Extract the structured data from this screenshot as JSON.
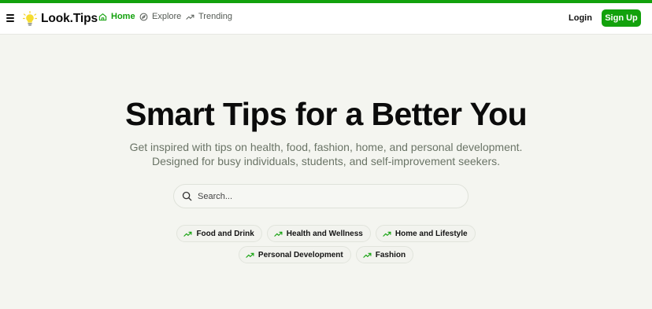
{
  "colors": {
    "accent": "#12a10c",
    "text_muted": "#6a7466",
    "background": "#f4f5f0"
  },
  "header": {
    "menu_icon": "hamburger-icon",
    "logo_icon": "lightbulb-icon",
    "brand": "Look.Tips",
    "nav": [
      {
        "label": "Home",
        "icon": "home-icon",
        "active": true
      },
      {
        "label": "Explore",
        "icon": "compass-icon",
        "active": false
      },
      {
        "label": "Trending",
        "icon": "trending-up-icon",
        "active": false
      }
    ],
    "login_label": "Login",
    "signup_label": "Sign Up"
  },
  "hero": {
    "title": "Smart Tips for a Better You",
    "subtitle_line1": "Get inspired with tips on health, food, fashion, home, and personal development.",
    "subtitle_line2": "Designed for busy individuals, students, and self-improvement seekers."
  },
  "search": {
    "placeholder": "Search...",
    "value": "",
    "icon": "search-icon"
  },
  "categories": [
    {
      "label": "Food and Drink",
      "icon": "trending-up-icon"
    },
    {
      "label": "Health and Wellness",
      "icon": "trending-up-icon"
    },
    {
      "label": "Home and Lifestyle",
      "icon": "trending-up-icon"
    },
    {
      "label": "Personal Development",
      "icon": "trending-up-icon"
    },
    {
      "label": "Fashion",
      "icon": "trending-up-icon"
    }
  ]
}
